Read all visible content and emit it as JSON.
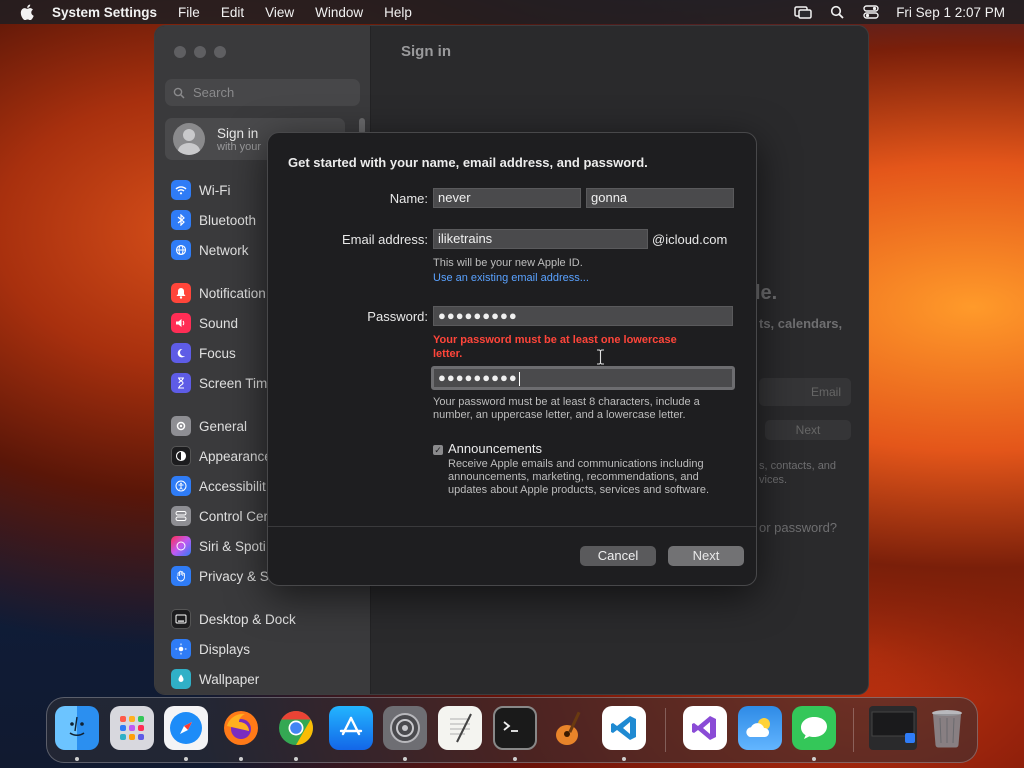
{
  "menubar": {
    "app_name": "System Settings",
    "menus": [
      "File",
      "Edit",
      "View",
      "Window",
      "Help"
    ],
    "clock": "Fri Sep 1  2:07 PM",
    "status_icons": [
      "screen-mirroring-icon",
      "spotlight-search-icon",
      "control-center-icon"
    ]
  },
  "window": {
    "title": "Sign in",
    "search_placeholder": "Search",
    "signin": {
      "title": "Sign in",
      "subtitle": "with your"
    },
    "sidebar_items": [
      {
        "label": "Wi-Fi",
        "icon": "wifi-icon",
        "color": "#2f7cf6"
      },
      {
        "label": "Bluetooth",
        "icon": "bluetooth-icon",
        "color": "#2f7cf6"
      },
      {
        "label": "Network",
        "icon": "network-icon",
        "color": "#2f7cf6"
      },
      {
        "label": "Notification",
        "icon": "notifications-icon",
        "color": "#ff453a"
      },
      {
        "label": "Sound",
        "icon": "sound-icon",
        "color": "#ff2d55"
      },
      {
        "label": "Focus",
        "icon": "focus-icon",
        "color": "#5e5ce6"
      },
      {
        "label": "Screen Tim",
        "icon": "screen-time-icon",
        "color": "#5e5ce6"
      },
      {
        "label": "General",
        "icon": "general-icon",
        "color": "#8e8e93"
      },
      {
        "label": "Appearance",
        "icon": "appearance-icon",
        "color": "#1c1c1e"
      },
      {
        "label": "Accessibilit",
        "icon": "accessibility-icon",
        "color": "#2f7cf6"
      },
      {
        "label": "Control Cer",
        "icon": "control-centre-icon",
        "color": "#8e8e93"
      },
      {
        "label": "Siri & Spoti",
        "icon": "siri-icon",
        "color": "#bf5af2"
      },
      {
        "label": "Privacy & S",
        "icon": "privacy-hand-icon",
        "color": "#2f7cf6"
      },
      {
        "label": "Desktop & Dock",
        "icon": "desktop-dock-icon",
        "color": "#1c1c1e"
      },
      {
        "label": "Displays",
        "icon": "displays-icon",
        "color": "#2f7cf6"
      },
      {
        "label": "Wallpaper",
        "icon": "wallpaper-icon",
        "color": "#30b0c7"
      }
    ],
    "background_fragments": {
      "headline_tail": "le.",
      "line1_tail": "ts, calendars,",
      "email_placeholder": "Email",
      "next": "Next",
      "line2_tail": "s, contacts, and",
      "line3_tail": "vices.",
      "forgot_tail": "or password?"
    }
  },
  "dialog": {
    "heading": "Get started with your name, email address, and password.",
    "name_label": "Name:",
    "first_name": "never",
    "last_name": "gonna",
    "email_label": "Email address:",
    "email_value": "iliketrains",
    "email_domain": "@icloud.com",
    "apple_id_hint": "This will be your new Apple ID.",
    "existing_email_link": "Use an existing email address...",
    "password_label": "Password:",
    "password_masked": "●●●●●●●●●",
    "password_error_line1": "Your password must be at least one lowercase",
    "password_error_line2": "letter.",
    "verify_masked": "●●●●●●●●●",
    "password_rules_line1": "Your password must be at least 8 characters, include a",
    "password_rules_line2": "number, an uppercase letter, and a lowercase letter.",
    "announcements_checked": true,
    "announcements_title": "Announcements",
    "announcements_desc_line1": "Receive Apple emails and communications including",
    "announcements_desc_line2": "announcements, marketing, recommendations, and",
    "announcements_desc_line3": "updates about Apple products, services and software.",
    "cancel_label": "Cancel",
    "next_label": "Next"
  },
  "dock": {
    "apps": [
      {
        "name": "finder-icon",
        "color": "#3aa0f0",
        "running": true
      },
      {
        "name": "launchpad-icon",
        "color": "#d0d0d6",
        "running": true
      },
      {
        "name": "safari-icon",
        "color": "#2a8ff7",
        "running": true
      },
      {
        "name": "firefox-icon",
        "color": "#ff7a18",
        "running": true
      },
      {
        "name": "chrome-icon",
        "color": "#f2f2f2",
        "running": true
      },
      {
        "name": "app-store-icon",
        "color": "#1d8cf8",
        "running": false
      },
      {
        "name": "system-settings-icon",
        "color": "#8e8e93",
        "running": true
      },
      {
        "name": "textedit-icon",
        "color": "#f0f0f0",
        "running": false
      },
      {
        "name": "terminal-icon",
        "color": "#1a1a1a",
        "running": true
      },
      {
        "name": "garageband-icon",
        "color": "#e8842a",
        "running": false
      },
      {
        "name": "vscode-icon",
        "color": "#ffffff",
        "running": true
      },
      {
        "name": "visual-studio-icon",
        "color": "#ffffff",
        "running": false
      },
      {
        "name": "weather-icon",
        "color": "#2e8be6",
        "running": false
      },
      {
        "name": "messages-icon",
        "color": "#34c759",
        "running": true
      },
      {
        "name": "terminal-window-icon",
        "color": "#2a2a2c",
        "running": false
      },
      {
        "name": "trash-icon",
        "color": "#9a9a9c",
        "running": false
      }
    ]
  }
}
